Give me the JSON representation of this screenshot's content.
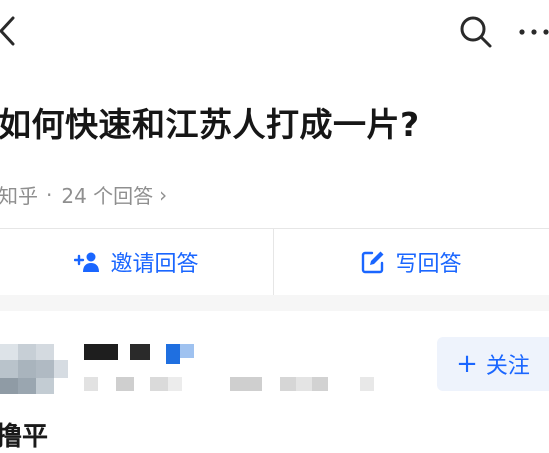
{
  "question": {
    "title": "如何快速和江苏人打成一片?"
  },
  "meta": {
    "source": "知乎",
    "separator": "·",
    "answers_count": "24 个回答",
    "arrow": "›"
  },
  "actions": {
    "invite_label": "邀请回答",
    "write_label": "写回答"
  },
  "answer": {
    "follow_label": "关注",
    "follow_plus": "+",
    "snippet": "撸平"
  },
  "icons": {
    "back": "chevron-left-icon",
    "search": "search-icon",
    "more": "more-icon",
    "invite": "add-person-icon",
    "write": "edit-icon"
  },
  "colors": {
    "accent": "#1a66ff",
    "meta_text": "#8f8f8f",
    "follow_bg": "#eef3fc"
  }
}
